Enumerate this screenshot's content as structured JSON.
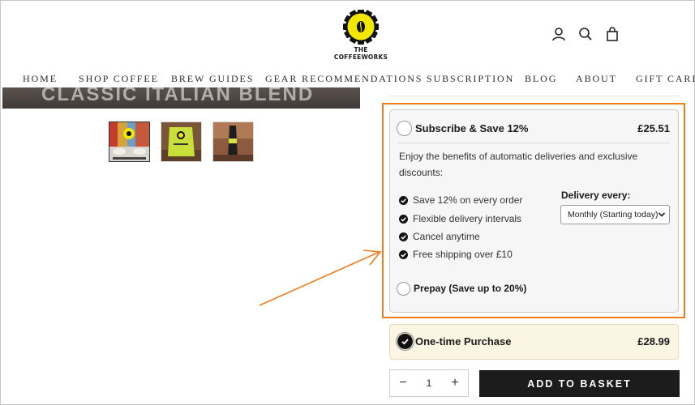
{
  "header": {
    "logo_text": "THE COFFEEWORKS",
    "icons": [
      "account-icon",
      "search-icon",
      "basket-icon"
    ]
  },
  "nav": {
    "items": [
      {
        "label": "HOME"
      },
      {
        "label": "SHOP COFFEE"
      },
      {
        "label": "BREW GUIDES"
      },
      {
        "label": "GEAR RECOMMENDATIONS"
      },
      {
        "label": "SUBSCRIPTION"
      },
      {
        "label": "BLOG"
      },
      {
        "label": "ABOUT"
      },
      {
        "label": "GIFT CARDS"
      }
    ]
  },
  "gallery": {
    "hero_text": "CLASSIC ITALIAN BLEND"
  },
  "subscribe": {
    "title": "Subscribe & Save 12%",
    "price": "£25.51",
    "description": "Enjoy the benefits of automatic deliveries and exclusive discounts:",
    "benefits": [
      "Save 12% on every order",
      "Flexible delivery intervals",
      "Cancel anytime",
      "Free shipping over £10"
    ],
    "delivery_label": "Delivery every:",
    "delivery_selected": "Monthly (Starting today)",
    "prepay_label": "Prepay (Save up to 20%)"
  },
  "one_time": {
    "title": "One-time Purchase",
    "price": "£28.99",
    "selected": true
  },
  "cart": {
    "quantity": "1",
    "minus": "−",
    "plus": "+",
    "add_label": "ADD TO BASKET"
  },
  "colors": {
    "highlight": "#f07c1b",
    "one_time_bg": "#fbf5e3",
    "button_bg": "#1c1c1c",
    "logo_yellow": "#f3e600"
  }
}
